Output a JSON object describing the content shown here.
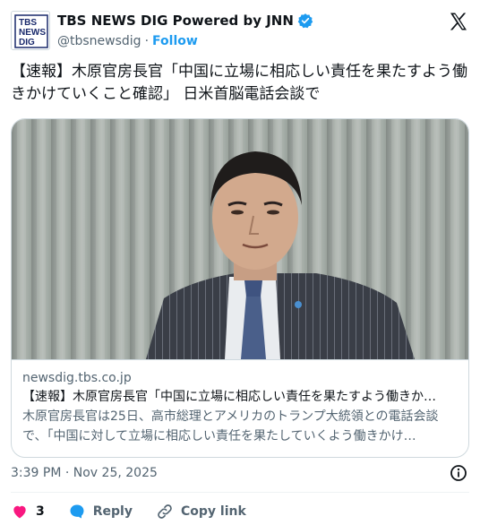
{
  "header": {
    "avatar_text": [
      "TBS",
      "NEWS",
      "DIG"
    ],
    "display_name": "TBS NEWS DIG Powered by JNN",
    "handle": "@tbsnewsdig",
    "separator": "·",
    "follow_label": "Follow"
  },
  "tweet": {
    "text": "【速報】木原官房長官「中国に立場に相応しい責任を果たすよう働きかけていくこと確認」 日米首脳電話会談で"
  },
  "card": {
    "domain": "newsdig.tbs.co.jp",
    "title": "【速報】木原官房長官「中国に立場に相応しい責任を果たすよう働きか…",
    "description": "木原官房長官は25日、高市総理とアメリカのトランプ大統領との電話会談で、「中国に対して立場に相応しい責任を果たしていくよう働きかけ…"
  },
  "timestamp": "3:39 PM · Nov 25, 2025",
  "actions": {
    "like_count": "3",
    "reply_label": "Reply",
    "copy_link_label": "Copy link"
  },
  "colors": {
    "accent": "#1d9bf0",
    "like": "#f91880",
    "text": "#0f1419",
    "muted": "#536471"
  }
}
